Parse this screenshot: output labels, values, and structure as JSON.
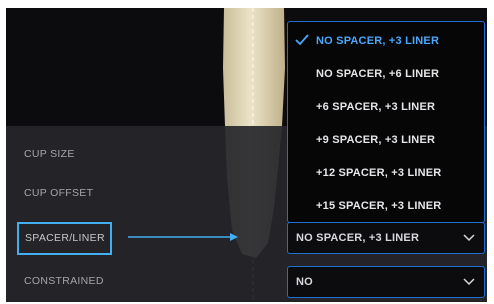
{
  "params": {
    "cup_size_label": "CUP SIZE",
    "cup_offset_label": "CUP OFFSET",
    "spacer_liner_label": "SPACER/LINER",
    "constrained_label": "CONSTRAINED"
  },
  "spacer_select": {
    "value": "NO SPACER, +3 LINER"
  },
  "constrained_select": {
    "value": "NO"
  },
  "dropdown": {
    "options": [
      "NO SPACER, +3 LINER",
      "NO SPACER, +6 LINER",
      "+6 SPACER, +3 LINER",
      "+9 SPACER, +3 LINER",
      "+12 SPACER, +3 LINER",
      "+15 SPACER, +3 LINER"
    ],
    "selected_index": 0
  },
  "colors": {
    "highlight": "#43aef2",
    "select_border": "#1f6fd1",
    "selected_option": "#4aa8ff"
  },
  "icons": [
    "checkmark-icon",
    "chevron-down-icon",
    "arrow-right-icon"
  ]
}
